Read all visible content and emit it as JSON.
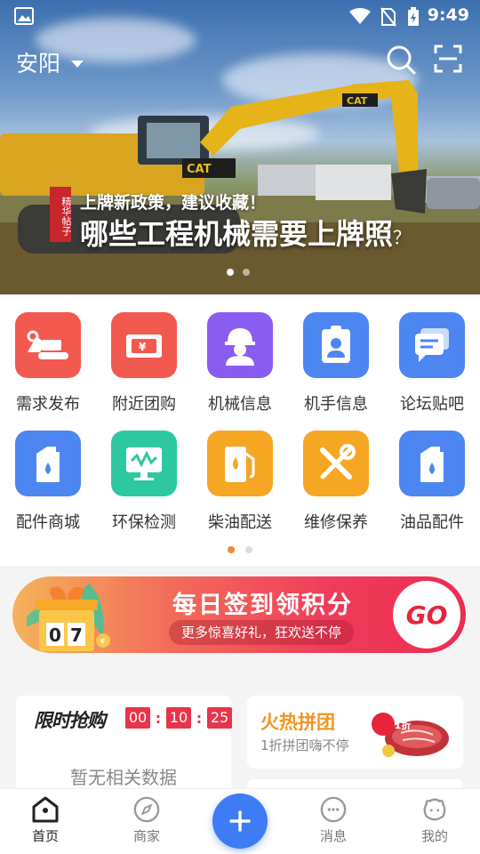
{
  "status_bar": {
    "time": "9:49",
    "icons": [
      "image-icon",
      "wifi-icon",
      "no-sim-icon",
      "battery-charging-icon"
    ]
  },
  "header": {
    "city": "安阳",
    "icons": [
      "search-icon",
      "scan-icon"
    ]
  },
  "banner": {
    "tag": "精华帖子",
    "subtitle": "上牌新政策，建议收藏！",
    "title": "哪些工程机械需要上牌照",
    "title_suffix": "？",
    "page_count": 2,
    "active_index": 0
  },
  "grid": {
    "items": [
      {
        "label": "需求发布",
        "icon": "excavator-icon",
        "color": "#f2594f"
      },
      {
        "label": "附近团购",
        "icon": "coupon-icon",
        "color": "#f2594f"
      },
      {
        "label": "机械信息",
        "icon": "worker-helmet-icon",
        "color": "#8a5cf0"
      },
      {
        "label": "机手信息",
        "icon": "id-badge-icon",
        "color": "#4d86f0"
      },
      {
        "label": "论坛贴吧",
        "icon": "chat-icon",
        "color": "#4d86f0"
      },
      {
        "label": "配件商城",
        "icon": "oil-bottle-icon",
        "color": "#4d86f0"
      },
      {
        "label": "环保检测",
        "icon": "monitor-icon",
        "color": "#2ec8a0"
      },
      {
        "label": "柴油配送",
        "icon": "fuel-pump-icon",
        "color": "#f5a623"
      },
      {
        "label": "维修保养",
        "icon": "tools-icon",
        "color": "#f5a623"
      },
      {
        "label": "油品配件",
        "icon": "oil-bottle-icon",
        "color": "#4d86f0"
      }
    ],
    "page_count": 2,
    "active_index": 0
  },
  "sign_banner": {
    "title": "每日签到领积分",
    "subtitle": "更多惊喜好礼，狂欢送不停",
    "go": "GO",
    "counter": [
      "0",
      "7"
    ]
  },
  "flash_sale": {
    "title": "限时抢购",
    "timer": [
      "00",
      "10",
      "25"
    ],
    "empty_text": "暂无相关数据"
  },
  "group_buy": {
    "title": "火热拼团",
    "subtitle": "1折拼团嗨不停",
    "badge": "1折"
  },
  "tabbar": {
    "tabs": [
      {
        "label": "首页",
        "icon": "home-icon",
        "active": true
      },
      {
        "label": "商家",
        "icon": "compass-icon",
        "active": false
      },
      {
        "label": "消息",
        "icon": "message-icon",
        "active": false
      },
      {
        "label": "我的",
        "icon": "profile-icon",
        "active": false
      }
    ],
    "fab_icon": "plus-icon"
  }
}
